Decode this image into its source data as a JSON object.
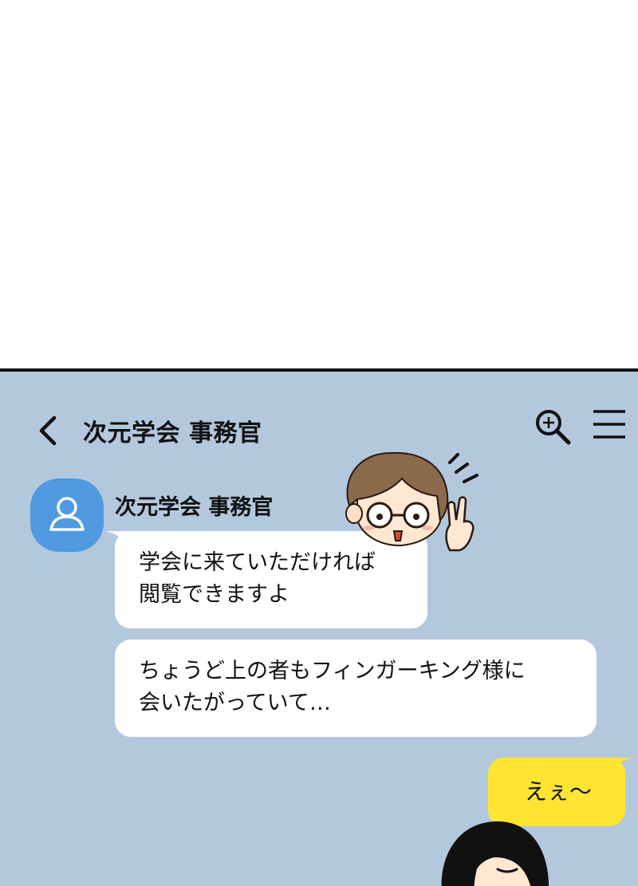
{
  "header": {
    "title": "次元学会 事務官",
    "back_icon": "chevron-left-icon",
    "search_icon": "zoom-in-icon",
    "menu_icon": "hamburger-menu-icon"
  },
  "conversation": {
    "sender_name": "次元学会 事務官",
    "avatar_icon": "user-icon",
    "incoming": [
      {
        "text": "学会に来ていただければ\n閲覧できますよ"
      },
      {
        "text": "ちょうど上の者もフィンガーキング様に\n会いたがっていて…"
      }
    ],
    "outgoing": [
      {
        "text": "えぇ〜"
      }
    ]
  },
  "colors": {
    "chat_background": "#b3c8dd",
    "incoming_bubble": "#ffffff",
    "outgoing_bubble": "#ffe432",
    "avatar": "#4f9ae0",
    "divider": "#111111"
  }
}
